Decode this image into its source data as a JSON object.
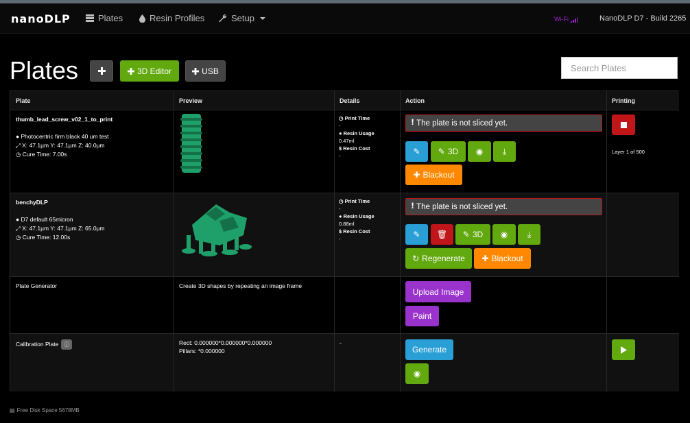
{
  "nav": {
    "brand": "nanoDLP",
    "items": [
      "Plates",
      "Resin Profiles",
      "Setup"
    ],
    "wifi": "Wi-Fi",
    "build": "NanoDLP D7 - Build 2265"
  },
  "page": {
    "title": "Plates",
    "btn_editor": "3D Editor",
    "btn_usb": "USB",
    "search_placeholder": "Search Plates"
  },
  "table": {
    "headers": [
      "Plate",
      "Preview",
      "Details",
      "Action",
      "Printing"
    ],
    "rows": [
      {
        "name": "thumb_lead_screw_v02_1_to_print",
        "profile": "Photocentric firm black 40 um test",
        "dims": "X: 47.1µm Y: 47.1µm Z: 40.0µm",
        "cure": "Cure Time: 7.00s",
        "print_time_label": "Print Time",
        "print_time": "-",
        "resin_usage_label": "Resin Usage",
        "resin_usage": "0.47ml",
        "resin_cost_label": "Resin Cost",
        "resin_cost": "-",
        "alert": "The plate is not sliced yet.",
        "btn_3d": "3D",
        "btn_blackout": "Blackout",
        "layer": "Layer 1 of 500"
      },
      {
        "name": "benchyDLP",
        "profile": "D7 default 65micron",
        "dims": "X: 47.1µm Y: 47.1µm Z: 65.0µm",
        "cure": "Cure Time: 12.00s",
        "print_time_label": "Print Time",
        "print_time": "-",
        "resin_usage_label": "Resin Usage",
        "resin_usage": "0.88ml",
        "resin_cost_label": "Resin Cost",
        "resin_cost": "-",
        "alert": "The plate is not sliced yet.",
        "btn_3d": "3D",
        "btn_regenerate": "Regenerate",
        "btn_blackout": "Blackout"
      },
      {
        "name": "Plate Generator",
        "preview_text": "Create 3D shapes by repeating an image frame",
        "btn_upload": "Upload Image",
        "btn_paint": "Paint"
      },
      {
        "name": "Calibration Plate",
        "rect": "Rect: 0.000000*0.000000*0.000000",
        "pillars": "Pillars: *0.000000",
        "details": "-",
        "btn_generate": "Generate"
      }
    ]
  },
  "footer": {
    "disk": "Free Disk Space 5678MB"
  },
  "colors": {
    "green": "#62a80f",
    "red": "#c0161a",
    "blue": "#2a9fd6",
    "orange": "#ff8800",
    "purple": "#9933cc",
    "model": "#1fa06a"
  }
}
